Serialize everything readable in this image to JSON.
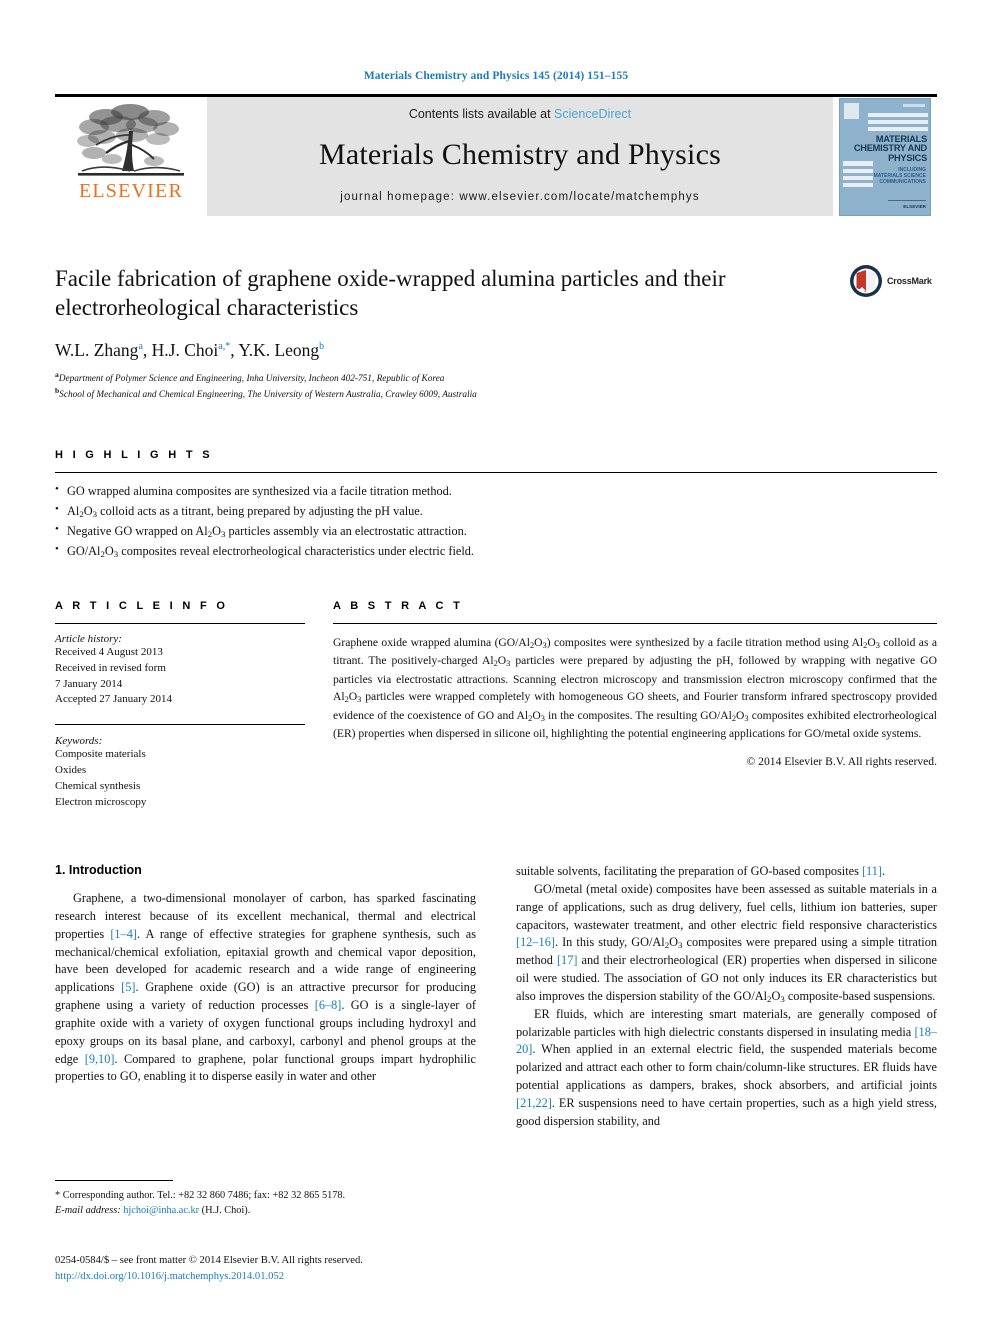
{
  "running_head": "Materials Chemistry and Physics 145 (2014) 151–155",
  "banner": {
    "publisher_name": "ELSEVIER",
    "contents_prefix": "Contents lists available at ",
    "contents_link": "ScienceDirect",
    "journal_title": "Materials Chemistry and Physics",
    "homepage": "journal homepage: www.elsevier.com/locate/matchemphys",
    "cover": {
      "title_line1": "MATERIALS",
      "title_line2": "CHEMISTRY AND",
      "title_line3": "PHYSICS",
      "subtitle_line1": "INCLUDING",
      "subtitle_line2": "MATERIALS SCIENCE",
      "subtitle_line3": "COMMUNICATIONS",
      "footer": "ELSEVIER"
    }
  },
  "article": {
    "title": "Facile fabrication of graphene oxide-wrapped alumina particles and their electrorheological characteristics",
    "authors": [
      {
        "name": "W.L. Zhang",
        "marks": "a"
      },
      {
        "name": "H.J. Choi",
        "marks": "a,*"
      },
      {
        "name": "Y.K. Leong",
        "marks": "b"
      }
    ],
    "affiliations": [
      {
        "mark": "a",
        "text": "Department of Polymer Science and Engineering, Inha University, Incheon 402-751, Republic of Korea"
      },
      {
        "mark": "b",
        "text": "School of Mechanical and Chemical Engineering, The University of Western Australia, Crawley 6009, Australia"
      }
    ],
    "crossmark_label": "CrossMark"
  },
  "highlights": {
    "heading": "H I G H L I G H T S",
    "items": [
      "GO wrapped alumina composites are synthesized via a facile titration method.",
      "Al₂O₃ colloid acts as a titrant, being prepared by adjusting the pH value.",
      "Negative GO wrapped on Al₂O₃ particles assembly via an electrostatic attraction.",
      "GO/Al₂O₃ composites reveal electrorheological characteristics under electric field."
    ]
  },
  "article_info": {
    "heading": "A R T I C L E   I N F O",
    "history_label": "Article history:",
    "history": [
      "Received 4 August 2013",
      "Received in revised form",
      "7 January 2014",
      "Accepted 27 January 2014"
    ],
    "keywords_label": "Keywords:",
    "keywords": [
      "Composite materials",
      "Oxides",
      "Chemical synthesis",
      "Electron microscopy"
    ]
  },
  "abstract": {
    "heading": "A B S T R A C T",
    "body": "Graphene oxide wrapped alumina (GO/Al₂O₃) composites were synthesized by a facile titration method using Al₂O₃ colloid as a titrant. The positively-charged Al₂O₃ particles were prepared by adjusting the pH, followed by wrapping with negative GO particles via electrostatic attractions. Scanning electron microscopy and transmission electron microscopy confirmed that the Al₂O₃ particles were wrapped completely with homogeneous GO sheets, and Fourier transform infrared spectroscopy provided evidence of the coexistence of GO and Al₂O₃ in the composites. The resulting GO/Al₂O₃ composites exhibited electrorheological (ER) properties when dispersed in silicone oil, highlighting the potential engineering applications for GO/metal oxide systems.",
    "copyright": "© 2014 Elsevier B.V. All rights reserved."
  },
  "body": {
    "section_heading": "1. Introduction",
    "left_paragraphs": [
      "Graphene, a two-dimensional monolayer of carbon, has sparked fascinating research interest because of its excellent mechanical, thermal and electrical properties [1–4]. A range of effective strategies for graphene synthesis, such as mechanical/chemical exfoliation, epitaxial growth and chemical vapor deposition, have been developed for academic research and a wide range of engineering applications [5]. Graphene oxide (GO) is an attractive precursor for producing graphene using a variety of reduction processes [6–8]. GO is a single-layer of graphite oxide with a variety of oxygen functional groups including hydroxyl and epoxy groups on its basal plane, and carboxyl, carbonyl and phenol groups at the edge [9,10]. Compared to graphene, polar functional groups impart hydrophilic properties to GO, enabling it to disperse easily in water and other"
    ],
    "right_paragraphs": [
      "suitable solvents, facilitating the preparation of GO-based composites [11].",
      "GO/metal (metal oxide) composites have been assessed as suitable materials in a range of applications, such as drug delivery, fuel cells, lithium ion batteries, super capacitors, wastewater treatment, and other electric field responsive characteristics [12–16]. In this study, GO/Al₂O₃ composites were prepared using a simple titration method [17] and their electrorheological (ER) properties when dispersed in silicone oil were studied. The association of GO not only induces its ER characteristics but also improves the dispersion stability of the GO/Al₂O₃ composite-based suspensions.",
      "ER fluids, which are interesting smart materials, are generally composed of polarizable particles with high dielectric constants dispersed in insulating media [18–20]. When applied in an external electric field, the suspended materials become polarized and attract each other to form chain/column-like structures. ER fluids have potential applications as dampers, brakes, shock absorbers, and artificial joints [21,22]. ER suspensions need to have certain properties, such as a high yield stress, good dispersion stability, and"
    ]
  },
  "footnote": {
    "corresponding": "* Corresponding author. Tel.: +82 32 860 7486; fax: +82 32 865 5178.",
    "email_label": "E-mail address:",
    "email": "hjchoi@inha.ac.kr",
    "email_suffix": "(H.J. Choi)."
  },
  "imprint": {
    "line1": "0254-0584/$ – see front matter © 2014 Elsevier B.V. All rights reserved.",
    "doi": "http://dx.doi.org/10.1016/j.matchemphys.2014.01.052"
  },
  "colors": {
    "link": "#1a7bb9",
    "elsevier_orange": "#E9711C",
    "banner_bg": "#e3e3e3",
    "cover_blue": "#8fb2cc"
  }
}
